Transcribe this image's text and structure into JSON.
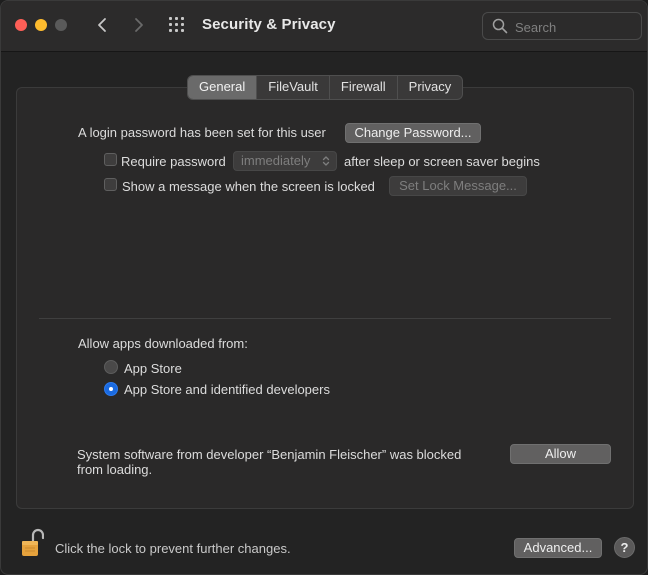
{
  "window": {
    "title": "Security & Privacy"
  },
  "search": {
    "placeholder": "Search",
    "value": ""
  },
  "tabs": [
    {
      "label": "General",
      "selected": true
    },
    {
      "label": "FileVault",
      "selected": false
    },
    {
      "label": "Firewall",
      "selected": false
    },
    {
      "label": "Privacy",
      "selected": false
    }
  ],
  "general": {
    "login_password_text": "A login password has been set for this user",
    "change_password_label": "Change Password...",
    "require_password_label": "Require password",
    "require_password_checked": false,
    "require_password_delay": "immediately",
    "after_sleep_text": "after sleep or screen saver begins",
    "show_message_label": "Show a message when the screen is locked",
    "show_message_checked": false,
    "set_lock_message_label": "Set Lock Message..."
  },
  "allow_apps": {
    "heading": "Allow apps downloaded from:",
    "options": [
      {
        "label": "App Store",
        "selected": false
      },
      {
        "label": "App Store and identified developers",
        "selected": true
      }
    ]
  },
  "blocked": {
    "line1": "System software from developer “Benjamin Fleischer” was blocked",
    "line2": "from loading.",
    "allow_label": "Allow"
  },
  "footer": {
    "lock_text": "Click the lock to prevent further changes.",
    "advanced_label": "Advanced...",
    "help_label": "?"
  },
  "colors": {
    "accent": "#1a6ae0",
    "close": "#fe5f57",
    "minimize": "#febc2e",
    "lock": "#e6a23c"
  }
}
